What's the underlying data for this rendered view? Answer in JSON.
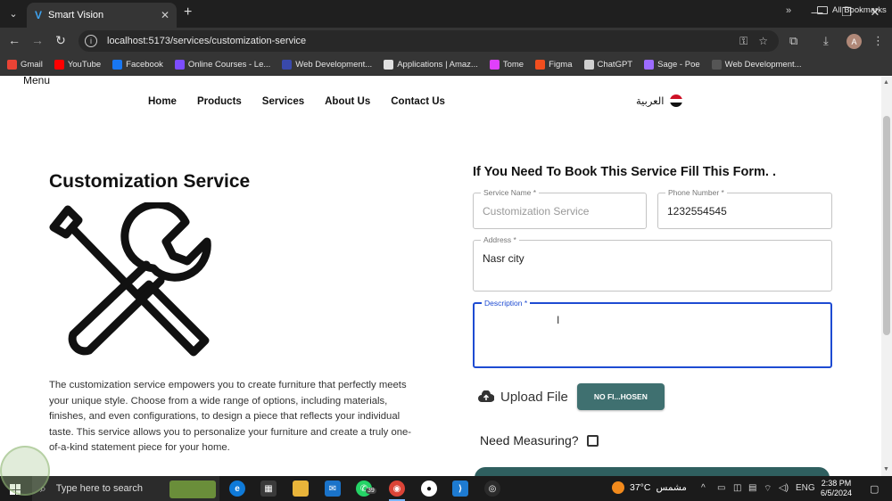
{
  "browser": {
    "tab_title": "Smart Vision",
    "tab_favicon": "V",
    "url": "localhost:5173/services/customization-service",
    "profile_initial": "A",
    "bookmarks": [
      {
        "label": "Gmail",
        "color": "#ea4335"
      },
      {
        "label": "YouTube",
        "color": "#ff0000"
      },
      {
        "label": "Facebook",
        "color": "#1877f2"
      },
      {
        "label": "Online Courses - Le...",
        "color": "#7c4dff"
      },
      {
        "label": "Web Development...",
        "color": "#3949ab"
      },
      {
        "label": "Applications | Amaz...",
        "color": "#e0e0e0"
      },
      {
        "label": "Tome",
        "color": "#e040fb"
      },
      {
        "label": "Figma",
        "color": "#f24e1e"
      },
      {
        "label": "ChatGPT",
        "color": "#cfcfcf"
      },
      {
        "label": "Sage - Poe",
        "color": "#9c6bff"
      },
      {
        "label": "Web Development...",
        "color": "#555555"
      }
    ],
    "all_bookmarks": "All Bookmarks"
  },
  "page": {
    "menu_label": "Menu",
    "nav": [
      "Home",
      "Products",
      "Services",
      "About Us",
      "Contact Us"
    ],
    "language": "العربية",
    "service_title": "Customization Service",
    "service_description": "The customization service empowers you to create furniture that perfectly meets your unique style. Choose from a wide range of options, including materials, finishes, and even configurations, to design a piece that reflects your individual taste. This service allows you to personalize your furniture and create a truly one-of-a-kind statement piece for your home.",
    "form_title": "If You Need To Book This Service Fill This Form. .",
    "fields": {
      "service_name": {
        "label": "Service Name *",
        "value": "Customization Service"
      },
      "phone_number": {
        "label": "Phone Number *",
        "value": "1232554545"
      },
      "address": {
        "label": "Address *",
        "value": "Nasr city"
      },
      "description": {
        "label": "Description *",
        "value": ""
      }
    },
    "upload_label": "Upload File",
    "file_button": "NO FI...HOSEN",
    "measuring_label": "Need Measuring?",
    "measuring_checked": false
  },
  "taskbar": {
    "search_placeholder": "Type here to search",
    "whatsapp_badge": "39",
    "weather_temp": "37°C",
    "weather_desc": "مشمس",
    "language": "ENG",
    "time": "2:38 PM",
    "date": "6/5/2024"
  }
}
